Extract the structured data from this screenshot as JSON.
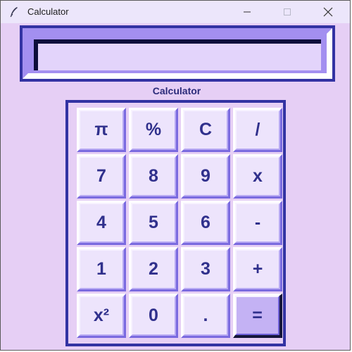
{
  "window": {
    "title": "Calculator",
    "controls": {
      "minimize": "minimize",
      "maximize": "maximize",
      "close": "close"
    }
  },
  "display": {
    "value": ""
  },
  "section_label": "Calculator",
  "keys": [
    [
      "π",
      "%",
      "C",
      "/"
    ],
    [
      "7",
      "8",
      "9",
      "x"
    ],
    [
      "4",
      "5",
      "6",
      "-"
    ],
    [
      "1",
      "2",
      "3",
      "+"
    ],
    [
      "x²",
      "0",
      ".",
      "="
    ]
  ],
  "colors": {
    "background": "#e6cff5",
    "frame": "#3333a3",
    "key_face": "#ede4fc",
    "key_text": "#30308c",
    "active_key": "#c4b2f4"
  }
}
